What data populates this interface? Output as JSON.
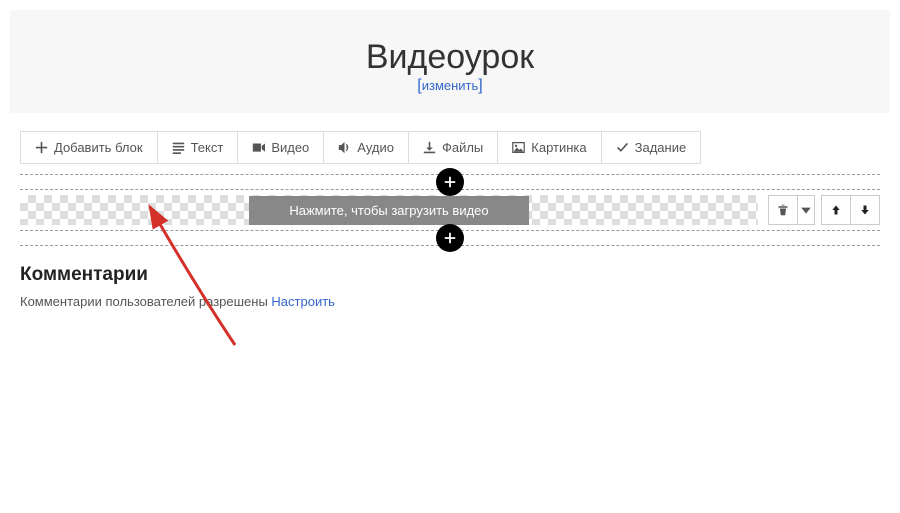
{
  "header": {
    "title": "Видеоурок",
    "edit_label": "изменить"
  },
  "toolbar": {
    "add_block": "Добавить блок",
    "text": "Текст",
    "video": "Видео",
    "audio": "Аудио",
    "files": "Файлы",
    "image": "Картинка",
    "task": "Задание"
  },
  "block": {
    "upload_prompt": "Нажмите, чтобы загрузить видео"
  },
  "comments": {
    "heading": "Комментарии",
    "status": "Комментарии пользователей разрешены ",
    "configure": "Настроить"
  }
}
